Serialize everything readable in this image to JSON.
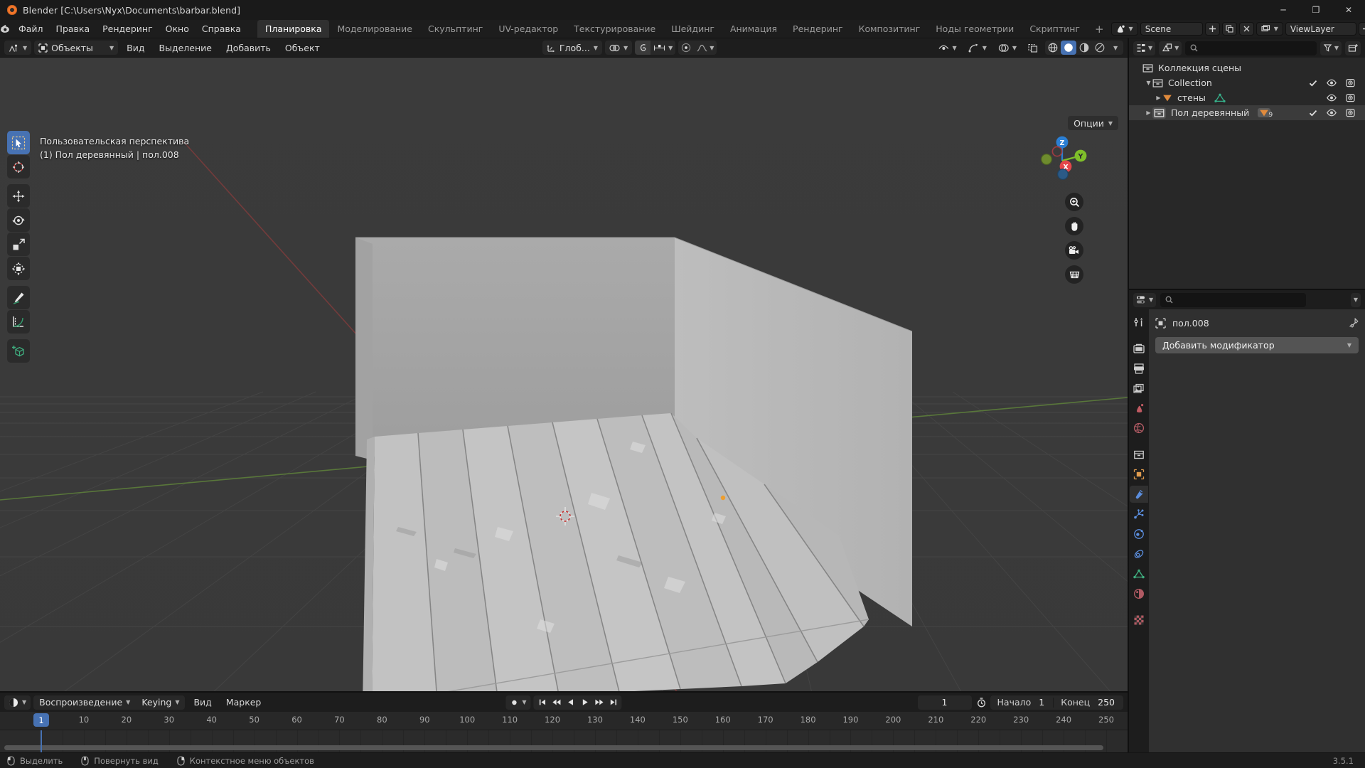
{
  "window": {
    "title": "Blender [C:\\Users\\Nyx\\Documents\\barbar.blend]",
    "minimize": "─",
    "maximize": "❐",
    "close": "✕"
  },
  "topbar": {
    "menus": [
      "Файл",
      "Правка",
      "Рендеринг",
      "Окно",
      "Справка"
    ],
    "workspaces": [
      "Планировка",
      "Моделирование",
      "Скульптинг",
      "UV-редактор",
      "Текстурирование",
      "Шейдинг",
      "Анимация",
      "Рендеринг",
      "Композитинг",
      "Ноды геометрии",
      "Скриптинг"
    ],
    "active_workspace": "Планировка",
    "add_workspace": "+",
    "scene_name": "Scene",
    "view_layer_name": "ViewLayer"
  },
  "viewport_header": {
    "mode": "Объекты",
    "menus": [
      "Вид",
      "Выделение",
      "Добавить",
      "Объект"
    ],
    "transform_orientation": "Глоб...",
    "options_label": "Опции"
  },
  "viewport": {
    "overlay_line1": "Пользовательская перспектива",
    "overlay_line2": "(1) Пол деревянный | пол.008",
    "gizmo_axes": {
      "x": "X",
      "y": "Y",
      "z": "Z"
    },
    "tools": [
      "tweak-select-tool",
      "cursor-tool",
      "move-tool",
      "rotate-tool",
      "scale-tool",
      "transform-tool",
      "annotate-tool",
      "measure-tool",
      "add-cube-tool"
    ],
    "nav_buttons": [
      "zoom-icon",
      "pan-hand-icon",
      "camera-view-icon",
      "ortho-persp-icon"
    ]
  },
  "timeline": {
    "playback_label": "Воспроизведение",
    "keying_label": "Keying",
    "view_label": "Вид",
    "marker_label": "Маркер",
    "current_frame": "1",
    "start_label": "Начало",
    "start_value": "1",
    "end_label": "Конец",
    "end_value": "250",
    "ticks": [
      "1",
      "10",
      "20",
      "30",
      "40",
      "50",
      "60",
      "70",
      "80",
      "90",
      "100",
      "110",
      "120",
      "130",
      "140",
      "150",
      "160",
      "170",
      "180",
      "190",
      "200",
      "210",
      "220",
      "230",
      "240",
      "250"
    ],
    "playhead_frame": "1"
  },
  "outliner": {
    "search_placeholder": "",
    "rows": [
      {
        "name": "Коллекция сцены",
        "depth": 0,
        "icon": "collection-icon",
        "expander": "none",
        "checkbox": false,
        "eye": false,
        "camera": false,
        "selected": false
      },
      {
        "name": "Collection",
        "depth": 1,
        "icon": "collection-icon",
        "expander": "open",
        "checkbox": true,
        "eye": true,
        "camera": true,
        "selected": false
      },
      {
        "name": "стены",
        "depth": 2,
        "icon": "mesh-object-icon",
        "expander": "closed",
        "checkbox": false,
        "eye": true,
        "camera": true,
        "selected": false,
        "data_icon": "mesh-data-icon"
      },
      {
        "name": "Пол деревянный",
        "depth": 1,
        "icon": "collection-instance-icon",
        "expander": "closed",
        "checkbox": true,
        "eye": true,
        "camera": true,
        "selected": true,
        "data_icon": "mesh-object-icon",
        "data_badge": "9"
      }
    ]
  },
  "properties": {
    "search_placeholder": "",
    "object_name": "пол.008",
    "add_modifier_label": "Добавить модификатор",
    "tabs": [
      "tool-icon",
      "render-icon",
      "output-icon",
      "view-layer-icon",
      "scene-icon",
      "world-icon",
      "collection-icon",
      "object-icon",
      "modifier-icon",
      "particles-icon",
      "physics-icon",
      "constraints-icon",
      "data-icon",
      "material-icon",
      "texture-icon"
    ],
    "active_tab": "modifier-icon"
  },
  "statusbar": {
    "hints": [
      {
        "icon": "mouse-left-icon",
        "label": "Выделить"
      },
      {
        "icon": "mouse-middle-icon",
        "label": "Повернуть вид"
      },
      {
        "icon": "mouse-right-icon",
        "label": "Контекстное меню объектов"
      }
    ],
    "version": "3.5.1"
  },
  "colors": {
    "accent": "#4772b3",
    "panel": "#303030",
    "bg": "#1d1d1d",
    "viewport": "#3a3a3a"
  }
}
